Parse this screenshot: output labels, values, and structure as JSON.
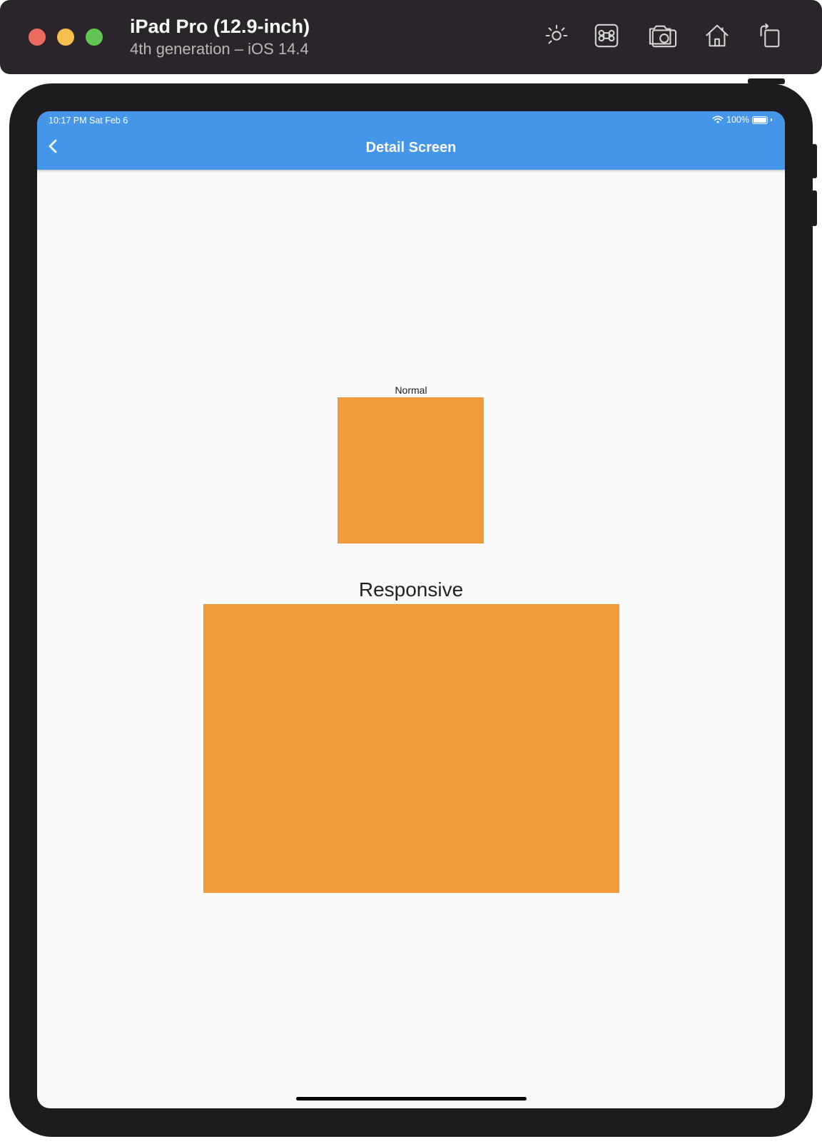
{
  "simulator": {
    "device_name": "iPad Pro (12.9-inch)",
    "device_detail": "4th generation – iOS 14.4",
    "toolbar_icons": [
      "brightness-icon",
      "command-icon",
      "screenshot-icon",
      "home-icon",
      "rotate-icon"
    ]
  },
  "status_bar": {
    "time_date": "10:17 PM   Sat Feb 6",
    "battery": "100%"
  },
  "app_bar": {
    "title": "Detail Screen",
    "back_icon": "chevron-left-icon",
    "color": "#4596e8"
  },
  "content": {
    "normal_label": "Normal",
    "responsive_label": "Responsive",
    "box_color": "#f29b3b",
    "background": "#fafafa"
  }
}
